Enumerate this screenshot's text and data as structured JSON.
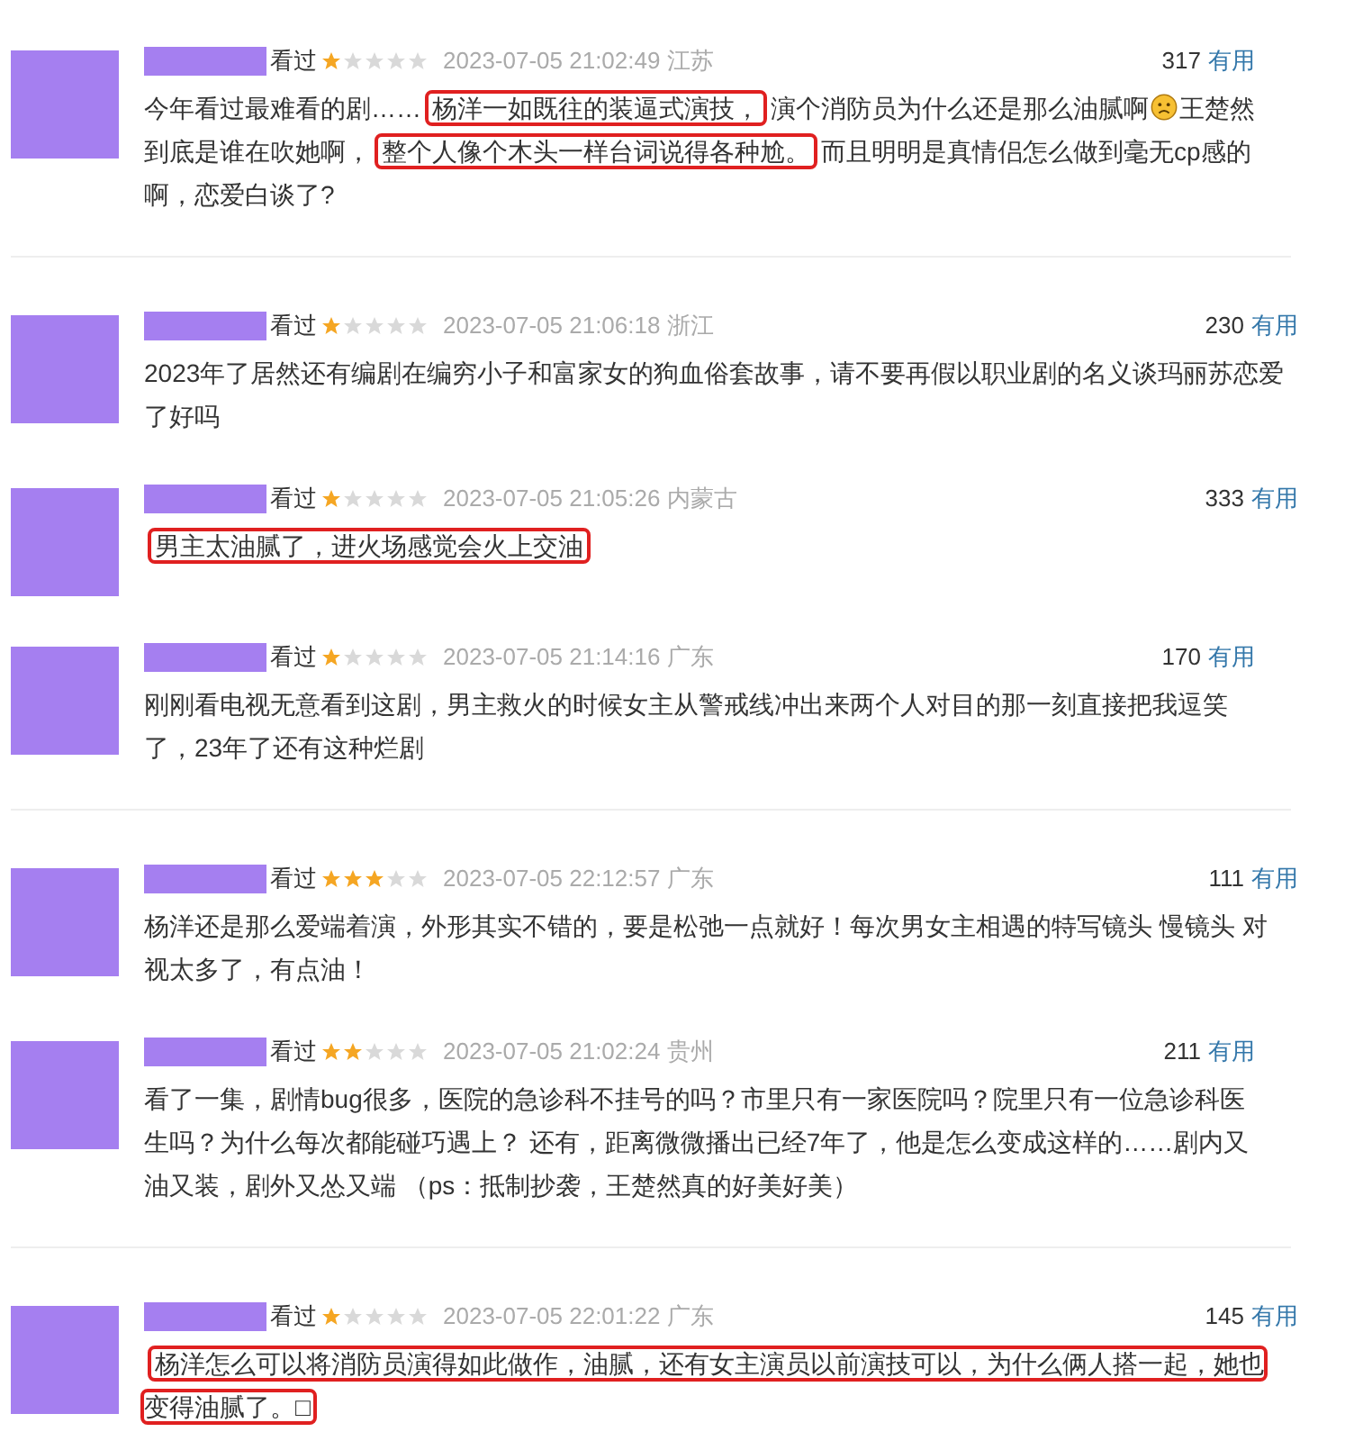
{
  "reviews": [
    {
      "status": "看过",
      "stars": 1,
      "time": "2023-07-05 21:02:49",
      "location": "江苏",
      "votes": "317",
      "useful": "有用",
      "divider": true,
      "segments": [
        {
          "kind": "text",
          "text": "今年看过最难看的剧……",
          "highlighted": false
        },
        {
          "kind": "text",
          "text": "杨洋一如既往的装逼式演技，",
          "highlighted": true
        },
        {
          "kind": "text",
          "text": "演个消防员为什么还是那么油腻啊",
          "highlighted": false
        },
        {
          "kind": "emoji",
          "highlighted": false
        },
        {
          "kind": "text",
          "text": "王楚然到底是谁在吹她啊，",
          "highlighted": false
        },
        {
          "kind": "text",
          "text": "整个人像个木头一样台词说得各种尬。",
          "highlighted": true
        },
        {
          "kind": "text",
          "text": "而且明明是真情侣怎么做到毫无cp感的啊，恋爱白谈了?",
          "highlighted": false
        }
      ]
    },
    {
      "status": "看过",
      "stars": 1,
      "time": "2023-07-05 21:06:18",
      "location": "浙江",
      "votes": "230",
      "useful": "有用",
      "divider": false,
      "segments": [
        {
          "kind": "text",
          "text": "2023年了居然还有编剧在编穷小子和富家女的狗血俗套故事，请不要再假以职业剧的名义谈玛丽苏恋爱了好吗",
          "highlighted": false
        }
      ]
    },
    {
      "status": "看过",
      "stars": 1,
      "time": "2023-07-05 21:05:26",
      "location": "内蒙古",
      "votes": "333",
      "useful": "有用",
      "divider": false,
      "segments": [
        {
          "kind": "text",
          "text": "男主太油腻了，进火场感觉会火上交油",
          "highlighted": true
        }
      ]
    },
    {
      "status": "看过",
      "stars": 1,
      "time": "2023-07-05 21:14:16",
      "location": "广东",
      "votes": "170",
      "useful": "有用",
      "divider": true,
      "segments": [
        {
          "kind": "text",
          "text": "刚刚看电视无意看到这剧，男主救火的时候女主从警戒线冲出来两个人对目的那一刻直接把我逗笑了，23年了还有这种烂剧",
          "highlighted": false
        }
      ]
    },
    {
      "status": "看过",
      "stars": 3,
      "time": "2023-07-05 22:12:57",
      "location": "广东",
      "votes": "111",
      "useful": "有用",
      "divider": false,
      "segments": [
        {
          "kind": "text",
          "text": "杨洋还是那么爱端着演，外形其实不错的，要是松弛一点就好！每次男女主相遇的特写镜头 慢镜头 对视太多了，有点油！",
          "highlighted": false
        }
      ]
    },
    {
      "status": "看过",
      "stars": 2,
      "time": "2023-07-05 21:02:24",
      "location": "贵州",
      "votes": "211",
      "useful": "有用",
      "divider": true,
      "segments": [
        {
          "kind": "text",
          "text": "看了一集，剧情bug很多，医院的急诊科不挂号的吗？市里只有一家医院吗？院里只有一位急诊科医生吗？为什么每次都能碰巧遇上？ 还有，距离微微播出已经7年了，他是怎么变成这样的……剧内又油又装，剧外又怂又端 （ps：抵制抄袭，王楚然真的好美好美）",
          "highlighted": false
        }
      ]
    },
    {
      "status": "看过",
      "stars": 1,
      "time": "2023-07-05 22:01:22",
      "location": "广东",
      "votes": "145",
      "useful": "有用",
      "divider": false,
      "segments": [
        {
          "kind": "text",
          "text": "杨洋怎么可以将消防员演得如此做作，油腻，还有女主演员以前演技可以，为什么俩人搭一起，她也变得油腻了。□",
          "highlighted": true
        }
      ]
    }
  ]
}
